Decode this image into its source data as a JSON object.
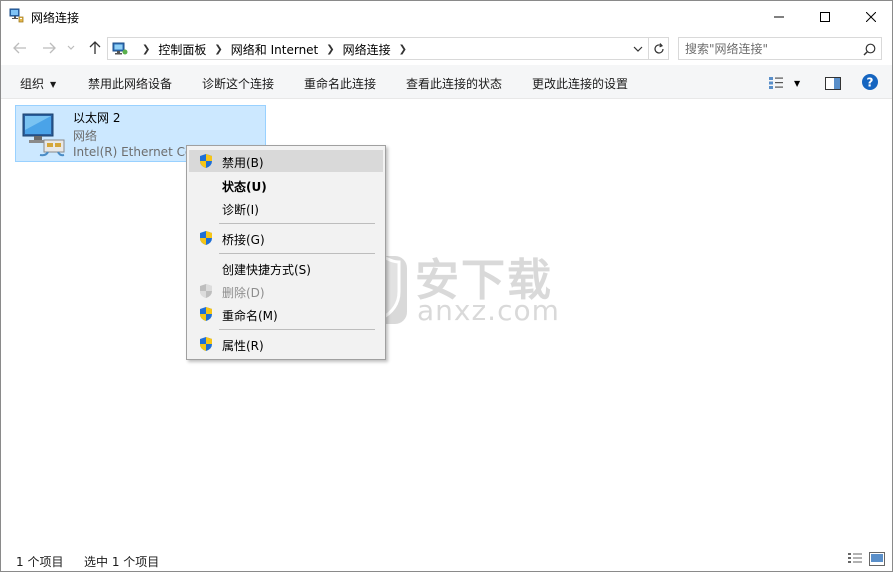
{
  "window": {
    "title": "网络连接",
    "icon": "network-connections-icon"
  },
  "address": {
    "crumbs": [
      "控制面板",
      "网络和 Internet",
      "网络连接"
    ]
  },
  "search": {
    "placeholder": "搜索\"网络连接\""
  },
  "commands": {
    "organize": "组织",
    "disable_device": "禁用此网络设备",
    "diagnose": "诊断这个连接",
    "rename": "重命名此连接",
    "view_status": "查看此连接的状态",
    "change_settings": "更改此连接的设置"
  },
  "connection": {
    "name": "以太网 2",
    "status": "网络",
    "device": "Intel(R) Ethernet Connection"
  },
  "context_menu": {
    "items": [
      {
        "label": "禁用(B)",
        "shield": true,
        "highlighted": true
      },
      {
        "label": "状态(U)",
        "bold": true
      },
      {
        "label": "诊断(I)"
      },
      {
        "label": "桥接(G)",
        "shield": true
      },
      {
        "label": "创建快捷方式(S)"
      },
      {
        "label": "删除(D)",
        "shield": true,
        "disabled": true
      },
      {
        "label": "重命名(M)",
        "shield": true
      },
      {
        "label": "属性(R)",
        "shield": true
      }
    ]
  },
  "watermark": {
    "cn": "安下载",
    "en": "anxz.com"
  },
  "status": {
    "count": "1 个项目",
    "selected": "选中 1 个项目"
  },
  "colors": {
    "selection_bg": "#cce8ff",
    "selection_border": "#99d1ff",
    "menu_bg": "#f2f2f2",
    "menu_highlight": "#d9d9d9",
    "help_blue": "#1565c0"
  }
}
